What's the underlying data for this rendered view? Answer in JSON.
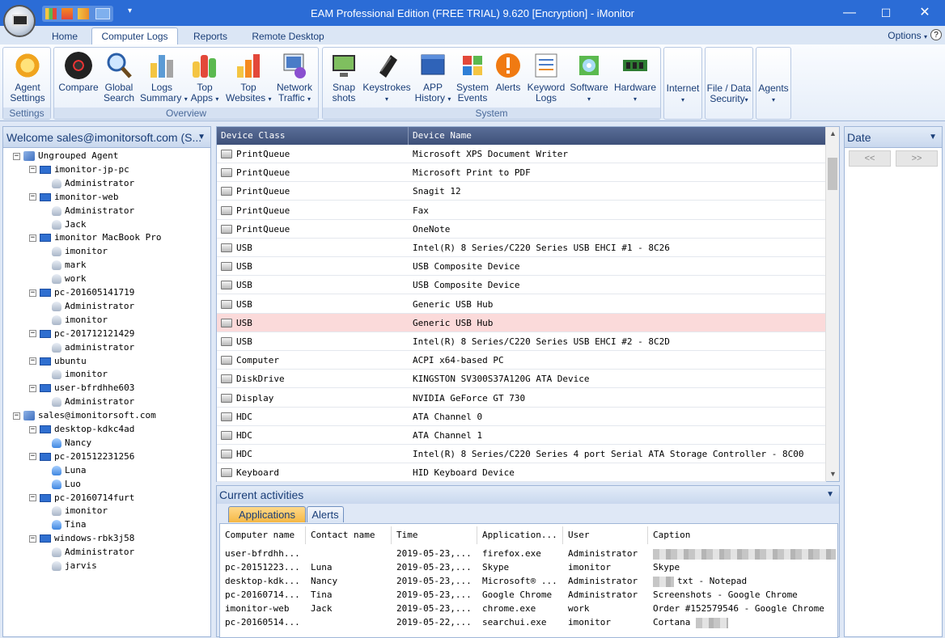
{
  "window": {
    "title": "EAM Professional Edition (FREE TRIAL) 9.620 [Encryption] - iMonitor",
    "minimize": "—",
    "maximize": "☐",
    "close": "✕"
  },
  "menu_tabs": [
    "Home",
    "Computer Logs",
    "Reports",
    "Remote Desktop"
  ],
  "active_tab": "Computer Logs",
  "options_label": "Options",
  "help_label": "?",
  "ribbon": {
    "groups": [
      {
        "title": "Settings",
        "buttons": [
          {
            "line1": "Agent",
            "line2": "Settings",
            "icon": "agent-settings-icon"
          }
        ]
      },
      {
        "title": "Overview",
        "buttons": [
          {
            "line1": "Compare",
            "line2": "",
            "icon": "compare-icon"
          },
          {
            "line1": "Global",
            "line2": "Search",
            "icon": "magnifier-icon"
          },
          {
            "line1": "Logs",
            "line2": "Summary",
            "icon": "bar-chart-icon",
            "arrow": true
          },
          {
            "line1": "Top",
            "line2": "Apps",
            "icon": "top-apps-icon",
            "arrow": true
          },
          {
            "line1": "Top",
            "line2": "Websites",
            "icon": "top-websites-icon",
            "arrow": true
          },
          {
            "line1": "Network",
            "line2": "Traffic",
            "icon": "network-traffic-icon",
            "arrow": true
          }
        ]
      },
      {
        "title": "System",
        "buttons": [
          {
            "line1": "Snap",
            "line2": "shots",
            "icon": "monitor-icon"
          },
          {
            "line1": "Keystrokes",
            "line2": "",
            "icon": "mouse-icon",
            "arrow": true
          },
          {
            "line1": "APP",
            "line2": "History",
            "icon": "app-history-icon",
            "arrow": true
          },
          {
            "line1": "System",
            "line2": "Events",
            "icon": "windows-logo-icon"
          },
          {
            "line1": "Alerts",
            "line2": "",
            "icon": "alert-icon"
          },
          {
            "line1": "Keyword",
            "line2": "Logs",
            "icon": "keyword-logs-icon"
          },
          {
            "line1": "Software",
            "line2": "",
            "icon": "software-icon",
            "arrow": true
          },
          {
            "line1": "Hardware",
            "line2": "",
            "icon": "hardware-icon",
            "arrow": true
          }
        ]
      },
      {
        "title": "",
        "buttons": [
          {
            "line1": "Internet",
            "line2": "",
            "icon": "",
            "arrow": true
          }
        ]
      },
      {
        "title": "",
        "buttons": [
          {
            "line1": "File / Data",
            "line2": "Security",
            "icon": "",
            "arrow": true
          }
        ]
      },
      {
        "title": "",
        "buttons": [
          {
            "line1": "Agents",
            "line2": "",
            "icon": "",
            "arrow": true
          }
        ]
      }
    ]
  },
  "left_panel": {
    "title": "Welcome sales@imonitorsoft.com (S...",
    "tree": [
      {
        "label": "Ungrouped Agent",
        "type": "group",
        "level": 0
      },
      {
        "label": "imonitor-jp-pc",
        "type": "pc",
        "level": 1
      },
      {
        "label": "Administrator",
        "type": "user",
        "level": 2
      },
      {
        "label": "imonitor-web",
        "type": "pc",
        "level": 1
      },
      {
        "label": "Administrator",
        "type": "user",
        "level": 2
      },
      {
        "label": "Jack",
        "type": "user",
        "level": 2
      },
      {
        "label": "imonitor  MacBook Pro",
        "type": "pc",
        "level": 1
      },
      {
        "label": "imonitor",
        "type": "user",
        "level": 2
      },
      {
        "label": "mark",
        "type": "user",
        "level": 2
      },
      {
        "label": "work",
        "type": "user",
        "level": 2
      },
      {
        "label": "pc-201605141719",
        "type": "pc",
        "level": 1
      },
      {
        "label": "Administrator",
        "type": "user",
        "level": 2
      },
      {
        "label": "imonitor",
        "type": "user",
        "level": 2
      },
      {
        "label": "pc-201712121429",
        "type": "pc",
        "level": 1
      },
      {
        "label": "administrator",
        "type": "user",
        "level": 2
      },
      {
        "label": "ubuntu",
        "type": "pc",
        "level": 1
      },
      {
        "label": "imonitor",
        "type": "user",
        "level": 2
      },
      {
        "label": "user-bfrdhhe603",
        "type": "pc",
        "level": 1
      },
      {
        "label": "Administrator",
        "type": "user",
        "level": 2
      },
      {
        "label": "sales@imonitorsoft.com",
        "type": "group",
        "level": 0
      },
      {
        "label": "desktop-kdkc4ad",
        "type": "pc",
        "level": 1
      },
      {
        "label": "Nancy",
        "type": "userb",
        "level": 2
      },
      {
        "label": "pc-201512231256",
        "type": "pc",
        "level": 1
      },
      {
        "label": "Luna",
        "type": "userb",
        "level": 2
      },
      {
        "label": "Luo",
        "type": "userb",
        "level": 2
      },
      {
        "label": "pc-20160714furt",
        "type": "pc",
        "level": 1
      },
      {
        "label": "imonitor",
        "type": "user",
        "level": 2
      },
      {
        "label": "Tina",
        "type": "userb",
        "level": 2
      },
      {
        "label": "windows-rbk3j58",
        "type": "pc",
        "level": 1
      },
      {
        "label": "Administrator",
        "type": "user",
        "level": 2
      },
      {
        "label": "jarvis",
        "type": "user",
        "level": 2
      }
    ]
  },
  "device_table": {
    "columns": [
      "Device Class",
      "Device Name"
    ],
    "selected_index": 9,
    "rows": [
      [
        "PrintQueue",
        "Microsoft XPS Document Writer"
      ],
      [
        "PrintQueue",
        "Microsoft Print to PDF"
      ],
      [
        "PrintQueue",
        "Snagit 12"
      ],
      [
        "PrintQueue",
        "Fax"
      ],
      [
        "PrintQueue",
        "OneNote"
      ],
      [
        "USB",
        "Intel(R) 8 Series/C220 Series USB EHCI #1 - 8C26"
      ],
      [
        "USB",
        "USB Composite Device"
      ],
      [
        "USB",
        "USB Composite Device"
      ],
      [
        "USB",
        "Generic USB Hub"
      ],
      [
        "USB",
        "Generic USB Hub"
      ],
      [
        "USB",
        "Intel(R) 8 Series/C220 Series USB EHCI #2 - 8C2D"
      ],
      [
        "Computer",
        "ACPI x64-based PC"
      ],
      [
        "DiskDrive",
        "KINGSTON SV300S37A120G ATA Device"
      ],
      [
        "Display",
        "NVIDIA GeForce GT 730"
      ],
      [
        "HDC",
        "ATA Channel 0"
      ],
      [
        "HDC",
        "ATA Channel 1"
      ],
      [
        "HDC",
        "Intel(R) 8 Series/C220 Series 4 port Serial ATA Storage Controller - 8C00"
      ],
      [
        "Keyboard",
        "HID Keyboard Device"
      ]
    ]
  },
  "date_panel": {
    "title": "Date",
    "prev": "<<",
    "next": ">>"
  },
  "activities": {
    "title": "Current activities",
    "tabs": [
      "Applications",
      "Alerts"
    ],
    "columns": [
      "Computer name",
      "Contact name",
      "Time",
      "Application...",
      "User",
      "Caption"
    ],
    "rows": [
      [
        "user-bfrdhh...",
        "",
        "2019-05-23,...",
        "firefox.exe",
        "Administrator",
        ""
      ],
      [
        "pc-20151223...",
        "Luna",
        "2019-05-23,...",
        "Skype",
        "imonitor",
        "Skype"
      ],
      [
        "desktop-kdk...",
        "Nancy",
        "2019-05-23,...",
        "Microsoft® ...",
        "Administrator",
        "txt - Notepad"
      ],
      [
        "pc-20160714...",
        "Tina",
        "2019-05-23,...",
        "Google Chrome",
        "Administrator",
        "Screenshots - Google Chrome"
      ],
      [
        "imonitor-web",
        "Jack",
        "2019-05-23,...",
        "chrome.exe",
        "work",
        "Order #152579546 - Google Chrome"
      ],
      [
        "pc-20160514...",
        "",
        "2019-05-22,...",
        "searchui.exe",
        "imonitor",
        "Cortana"
      ]
    ]
  }
}
